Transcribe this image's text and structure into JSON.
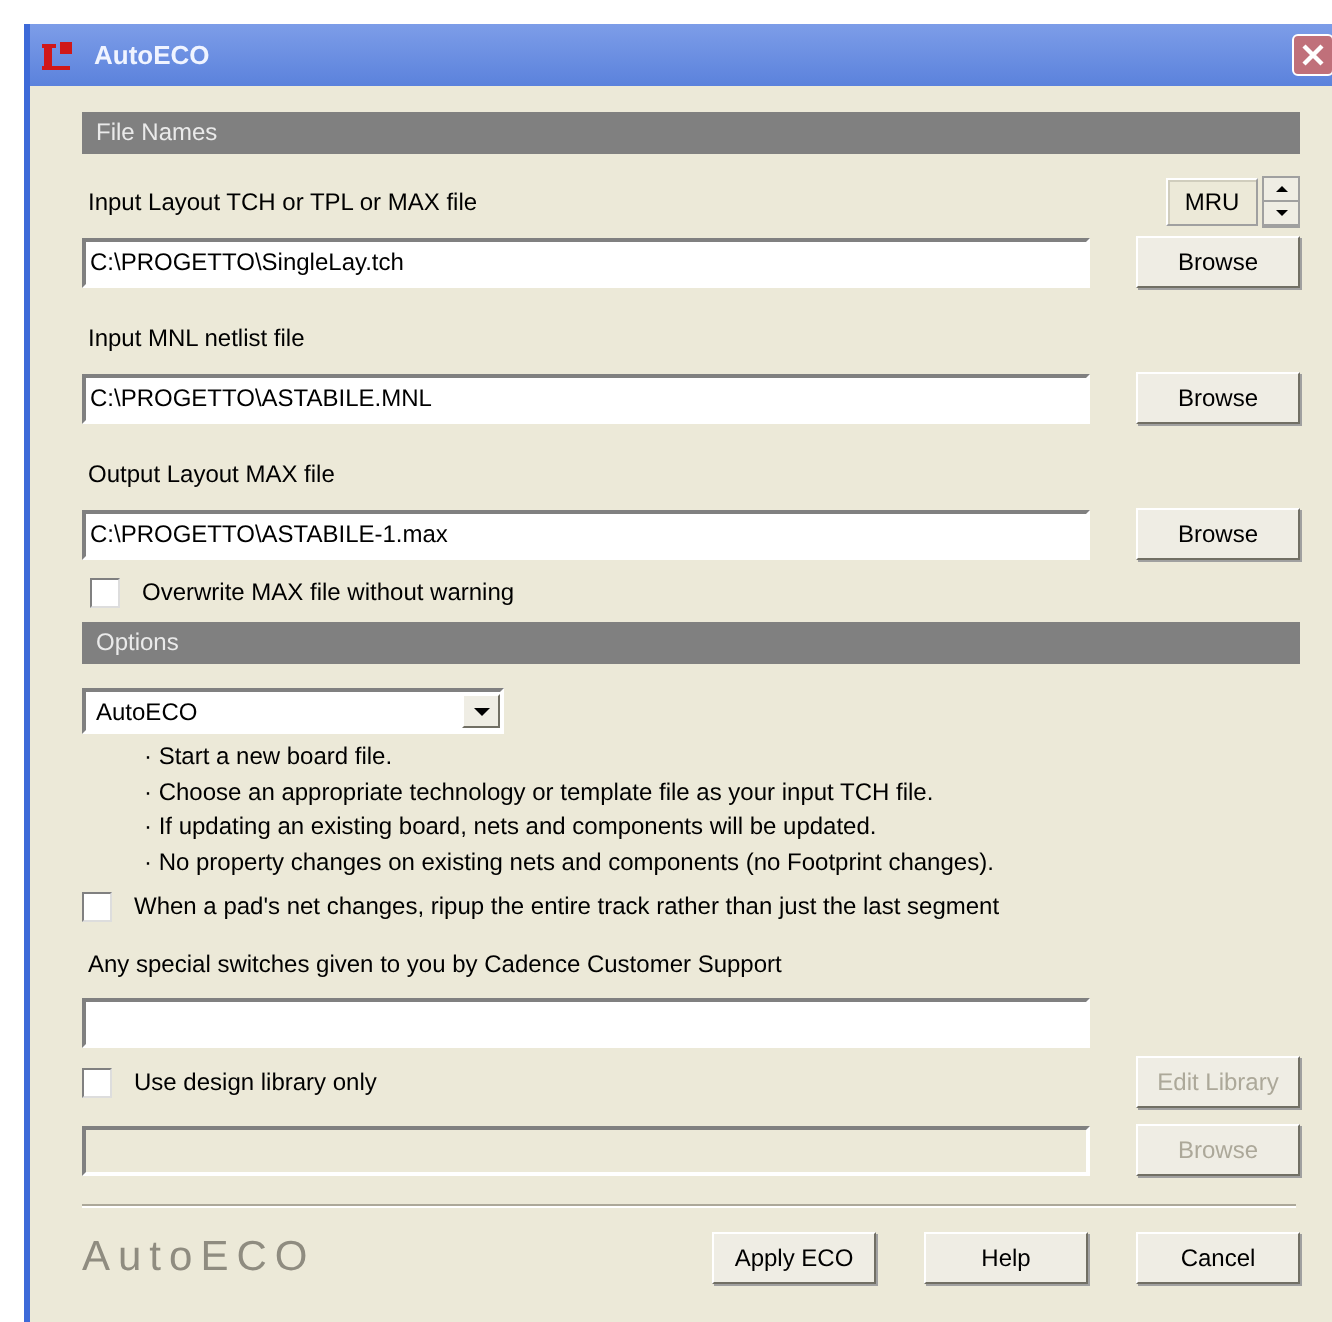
{
  "window": {
    "title": "AutoECO"
  },
  "file_names": {
    "header": "File Names",
    "mru": "MRU",
    "files": [
      {
        "label": "Input Layout TCH or TPL or MAX file",
        "value": "C:\\PROGETTO\\SingleLay.tch",
        "button": "Browse"
      },
      {
        "label": "Input MNL netlist file",
        "value": "C:\\PROGETTO\\ASTABILE.MNL",
        "button": "Browse"
      },
      {
        "label": "Output Layout MAX file",
        "value": "C:\\PROGETTO\\ASTABILE-1.max",
        "button": "Browse"
      }
    ],
    "overwrite": {
      "label": "Overwrite MAX file without warning",
      "checked": false
    }
  },
  "options": {
    "header": "Options",
    "mode": "AutoECO",
    "notes": [
      "· Start a new board file.",
      "· Choose an appropriate technology or template file as your input TCH file.",
      "· If updating an existing board, nets and components will be updated.",
      "· No property changes on existing nets and components (no Footprint changes)."
    ],
    "ripup": {
      "label": "When a pad's net changes, ripup the entire track rather than just the last segment",
      "checked": false
    },
    "switches": {
      "label": "Any special switches given to you by Cadence Customer Support"
    },
    "design_library": {
      "label": "Use design library only",
      "checked": false
    },
    "edit_library": {
      "label": "Edit Library",
      "disabled": true
    },
    "library_path": {
      "disabled": true
    },
    "library_browse": {
      "label": "Browse",
      "disabled": true
    }
  },
  "footer": {
    "logo": "AutoECO",
    "buttons": [
      "Apply ECO",
      "Help",
      "Cancel"
    ]
  }
}
